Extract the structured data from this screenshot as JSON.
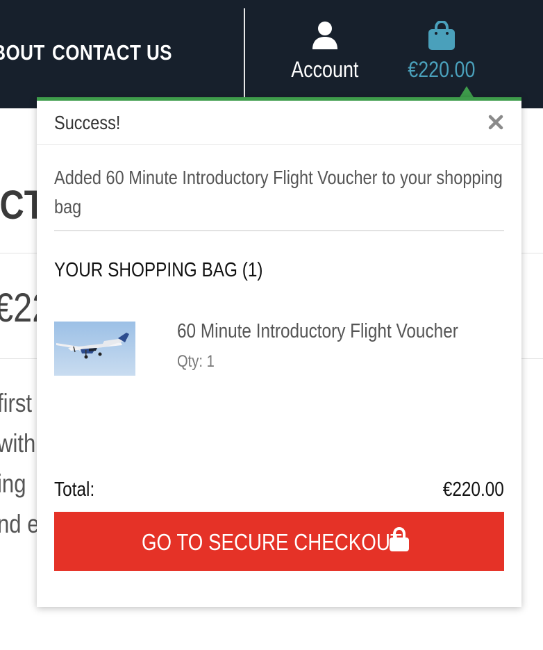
{
  "nav": {
    "about_label": "ABOUT",
    "contact_label": "CONTACT US",
    "account_label": "Account",
    "account_icon": "user-icon",
    "bag_total": "€220.00",
    "bag_icon": "shopping-bag-icon",
    "bag_color": "#4aa0bb"
  },
  "background": {
    "title_fragment": "ICT",
    "price_fragment": "€22",
    "text_lines": [
      "first",
      "with",
      "ing",
      "nd e"
    ]
  },
  "popup": {
    "title": "Success!",
    "close_icon": "close-icon",
    "message": "Added 60 Minute Introductory Flight Voucher to your shopping bag",
    "bag_heading": "YOUR SHOPPING BAG (1)",
    "items": [
      {
        "name": "60 Minute Introductory Flight Voucher",
        "qty": "Qty: 1",
        "thumbnail": "airplane-photo"
      }
    ],
    "total_label": "Total:",
    "total_value": "€220.00",
    "checkout_label": "GO TO SECURE CHECKOUT",
    "checkout_icon": "lock-icon",
    "accent_color": "#3e9c4b",
    "checkout_color": "#e53227"
  }
}
